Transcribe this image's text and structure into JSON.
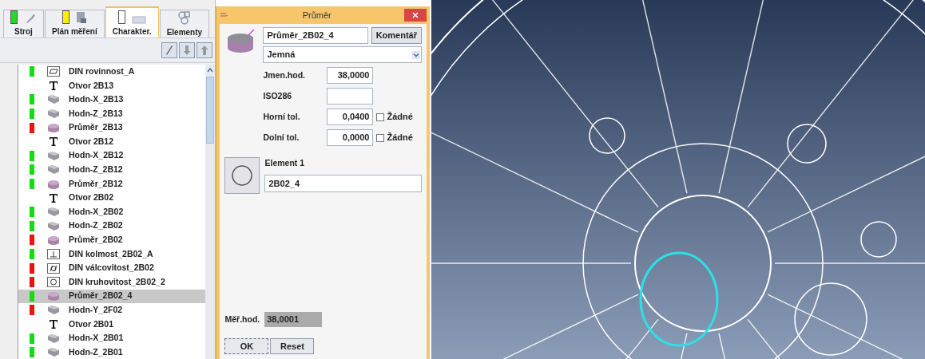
{
  "tabs": [
    {
      "label": "Stroj",
      "kind": "machine",
      "color": "#22dd22",
      "selected": false
    },
    {
      "label": "Plán měření",
      "kind": "plan",
      "color": "#ffee00",
      "selected": false
    },
    {
      "label": "Charakter.",
      "kind": "characteristic",
      "color": "#ffffff",
      "selected": true
    },
    {
      "label": "Elementy",
      "kind": "elements",
      "selected": false
    }
  ],
  "rows": [
    {
      "label": "DIN rovinnost_A",
      "kind": "flatness",
      "color": "#11dd11",
      "selected": false
    },
    {
      "label": "Otvor 2B13",
      "kind": "text",
      "selected": false
    },
    {
      "label": "Hodn-X_2B13",
      "kind": "value",
      "color": "#11dd11",
      "selected": false
    },
    {
      "label": "Hodn-Z_2B13",
      "kind": "value",
      "color": "#11dd11",
      "selected": false
    },
    {
      "label": "Průměr_2B13",
      "kind": "diameter",
      "color": "#ee1111",
      "selected": false
    },
    {
      "label": "Otvor 2B12",
      "kind": "text",
      "selected": false
    },
    {
      "label": "Hodn-X_2B12",
      "kind": "value",
      "color": "#11dd11",
      "selected": false
    },
    {
      "label": "Hodn-Z_2B12",
      "kind": "value",
      "color": "#11dd11",
      "selected": false
    },
    {
      "label": "Průměr_2B12",
      "kind": "diameter",
      "color": "#11dd11",
      "selected": false
    },
    {
      "label": "Otvor 2B02",
      "kind": "text",
      "selected": false
    },
    {
      "label": "Hodn-X_2B02",
      "kind": "value",
      "color": "#11dd11",
      "selected": false
    },
    {
      "label": "Hodn-Z_2B02",
      "kind": "value",
      "color": "#11dd11",
      "selected": false
    },
    {
      "label": "Průměr_2B02",
      "kind": "diameter",
      "color": "#ee1111",
      "selected": false
    },
    {
      "label": "DIN kolmost_2B02_A",
      "kind": "perpendicularity",
      "color": "#11dd11",
      "selected": false
    },
    {
      "label": "DIN válcovitost_2B02",
      "kind": "cylindricity",
      "color": "#ee1111",
      "selected": false
    },
    {
      "label": "DIN kruhovitost_2B02_2",
      "kind": "circularity",
      "color": "#ee1111",
      "selected": false
    },
    {
      "label": "Průměr_2B02_4",
      "kind": "diameter",
      "color": "#11dd11",
      "selected": true
    },
    {
      "label": "Hodn-Y_2F02",
      "kind": "value",
      "color": "#ee1111",
      "selected": false
    },
    {
      "label": "Otvor 2B01",
      "kind": "text",
      "selected": false
    },
    {
      "label": "Hodn-X_2B01",
      "kind": "value",
      "color": "#11dd11",
      "selected": false
    },
    {
      "label": "Hodn-Z_2B01",
      "kind": "value",
      "color": "#11dd11",
      "selected": false
    }
  ],
  "dialog": {
    "title": "Průměr",
    "name": "Průměr_2B02_4",
    "comment_button": "Komentář",
    "grade": "Jemná",
    "fields": [
      {
        "label": "Jmen.hod.",
        "value": "38,0000"
      },
      {
        "label": "ISO286"
      },
      {
        "label": "Horní tol.",
        "value": "0,0400",
        "none": {
          "label": "Žádné",
          "checked": false
        }
      },
      {
        "label": "Dolní tol.",
        "value": "0,0000",
        "none": {
          "label": "Žádné",
          "checked": false
        }
      }
    ],
    "element": {
      "label": "Element 1",
      "value": "2B02_4"
    },
    "measured": {
      "label": "Měř.hod.",
      "value": "38,0001"
    },
    "buttons": [
      "OK",
      "Reset"
    ]
  }
}
